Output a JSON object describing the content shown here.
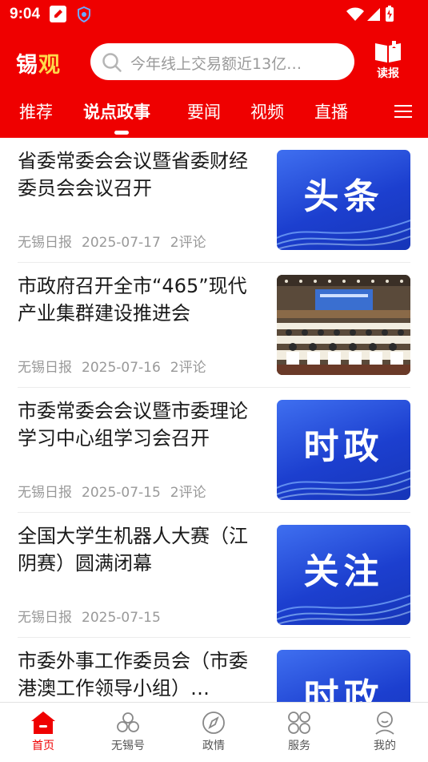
{
  "status_bar": {
    "time": "9:04"
  },
  "brand": {
    "logo_part1": "锡",
    "logo_part2": "观",
    "accent": "#ef0000",
    "logo_accent": "#ffd84a"
  },
  "search": {
    "placeholder": "今年线上交易额近13亿…"
  },
  "read_button": {
    "label": "读报",
    "icon": "open-book-icon"
  },
  "tabs": [
    {
      "label": "推荐",
      "active": false
    },
    {
      "label": "说点政事",
      "active": true
    },
    {
      "label": "要闻",
      "active": false
    },
    {
      "label": "视频",
      "active": false
    },
    {
      "label": "直播",
      "active": false
    }
  ],
  "news": [
    {
      "title": "省委常委会会议暨省委财经委员会会议召开",
      "source": "无锡日报",
      "date": "2025-07-17",
      "comments": "2评论",
      "thumb_text": "头条"
    },
    {
      "title": "市政府召开全市“465”现代产业集群建设推进会",
      "source": "无锡日报",
      "date": "2025-07-16",
      "comments": "2评论",
      "thumb_text": ""
    },
    {
      "title": "市委常委会会议暨市委理论学习中心组学习会召开",
      "source": "无锡日报",
      "date": "2025-07-15",
      "comments": "2评论",
      "thumb_text": "时政"
    },
    {
      "title": "全国大学生机器人大赛（江阴赛）圆满闭幕",
      "source": "无锡日报",
      "date": "2025-07-15",
      "comments": "",
      "thumb_text": "关注"
    },
    {
      "title": "市委外事工作委员会（市委港澳工作领导小组）…",
      "source": "",
      "date": "",
      "comments": "",
      "thumb_text": "时政"
    }
  ],
  "bottom_nav": [
    {
      "label": "首页",
      "icon": "home-icon",
      "active": true
    },
    {
      "label": "无锡号",
      "icon": "wuxi-hao-icon",
      "active": false
    },
    {
      "label": "政情",
      "icon": "compass-icon",
      "active": false
    },
    {
      "label": "服务",
      "icon": "services-grid-icon",
      "active": false
    },
    {
      "label": "我的",
      "icon": "profile-icon",
      "active": false
    }
  ]
}
